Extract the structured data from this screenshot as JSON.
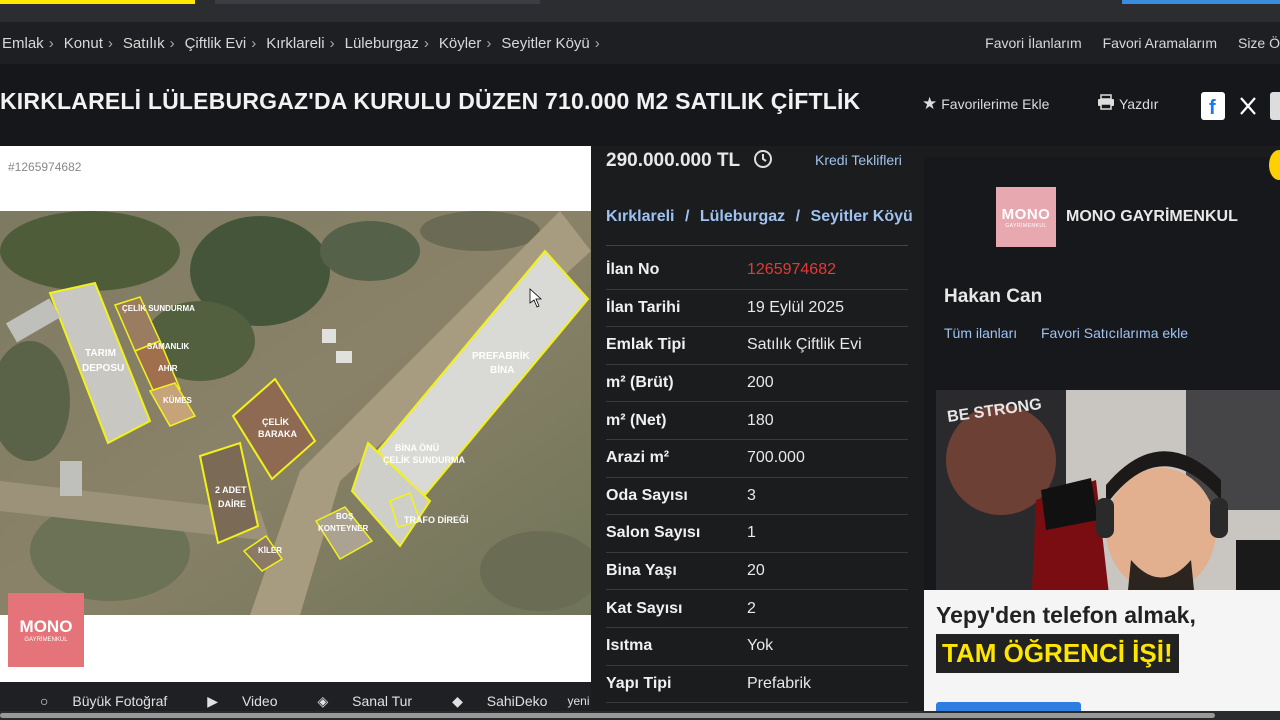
{
  "breadcrumb": {
    "items": [
      "Emlak",
      "Konut",
      "Satılık",
      "Çiftlik Evi",
      "Kırklareli",
      "Lüleburgaz",
      "Köyler",
      "Seyitler Köyü"
    ],
    "separator": "›"
  },
  "top_links": {
    "favorites": "Favori İlanlarım",
    "searches": "Favori Aramalarım",
    "to_you": "Size Ö"
  },
  "listing": {
    "title": "KIRKLARELİ LÜLEBURGAZ'DA KURULU DÜZEN 710.000 M2 SATILIK ÇİFTLİK",
    "add_favorite": "Favorilerime Ekle",
    "print": "Yazdır",
    "photo_id": "#1265974682"
  },
  "aerial_labels": {
    "tarim": "TARIM",
    "deposu": "DEPOSU",
    "celik_sundurma": "ÇELİK SUNDURMA",
    "samanlik": "SAMANLIK",
    "ahir": "AHIR",
    "kumes": "KÜMES",
    "celik": "ÇELİK",
    "baraka": "BARAKA",
    "adet": "2 ADET",
    "daire": "DAİRE",
    "kiler": "KİLER",
    "bos": "BOŞ",
    "konteyner": "KONTEYNER",
    "trafo": "TRAFO DİREĞİ",
    "bina_onu": "BİNA ÖNÜ",
    "celik_sundurma2": "ÇELİK SUNDURMA",
    "prefabrik": "PREFABRİK",
    "bina": "BİNA"
  },
  "watermark": {
    "mono": "MONO",
    "sub": "GAYRİMENKUL"
  },
  "media_bar": {
    "big_photo": "Büyük Fotoğraf",
    "video": "Video",
    "virtual_tour": "Sanal Tur",
    "sahideko": "SahiDeko",
    "new_badge": "yeni"
  },
  "price": {
    "value": "290.000.000 TL",
    "credit_offers": "Kredi Teklifleri"
  },
  "location": {
    "city": "Kırklareli",
    "district": "Lüleburgaz",
    "neighborhood": "Seyitler Köyü",
    "separator": "/"
  },
  "details": [
    {
      "key": "İlan No",
      "value": "1265974682"
    },
    {
      "key": "İlan Tarihi",
      "value": "19 Eylül 2025"
    },
    {
      "key": "Emlak Tipi",
      "value": "Satılık Çiftlik Evi"
    },
    {
      "key": "m² (Brüt)",
      "value": "200"
    },
    {
      "key": "m² (Net)",
      "value": "180"
    },
    {
      "key": "Arazi m²",
      "value": "700.000"
    },
    {
      "key": "Oda Sayısı",
      "value": "3"
    },
    {
      "key": "Salon Sayısı",
      "value": "1"
    },
    {
      "key": "Bina Yaşı",
      "value": "20"
    },
    {
      "key": "Kat Sayısı",
      "value": "2"
    },
    {
      "key": "Isıtma",
      "value": "Yok"
    },
    {
      "key": "Yapı Tipi",
      "value": "Prefabrik"
    }
  ],
  "seller": {
    "logo_text": "MONO",
    "logo_sub": "GAYRİMENKUL",
    "name": "MONO GAYRİMENKUL",
    "agent": "Hakan Can",
    "all_listings": "Tüm ilanları",
    "add_favorite_seller": "Favori Satıcılarıma ekle"
  },
  "ad": {
    "line1": "Yepy'den telefon almak,",
    "line2": "TAM ÖĞRENCİ İŞİ!"
  },
  "webcam": {
    "poster_text": "BE STRONG"
  },
  "colors": {
    "link": "#9fc2f0",
    "listing_no": "#e53935",
    "outline": "#f2f21a",
    "accent_yellow": "#ffe800"
  }
}
